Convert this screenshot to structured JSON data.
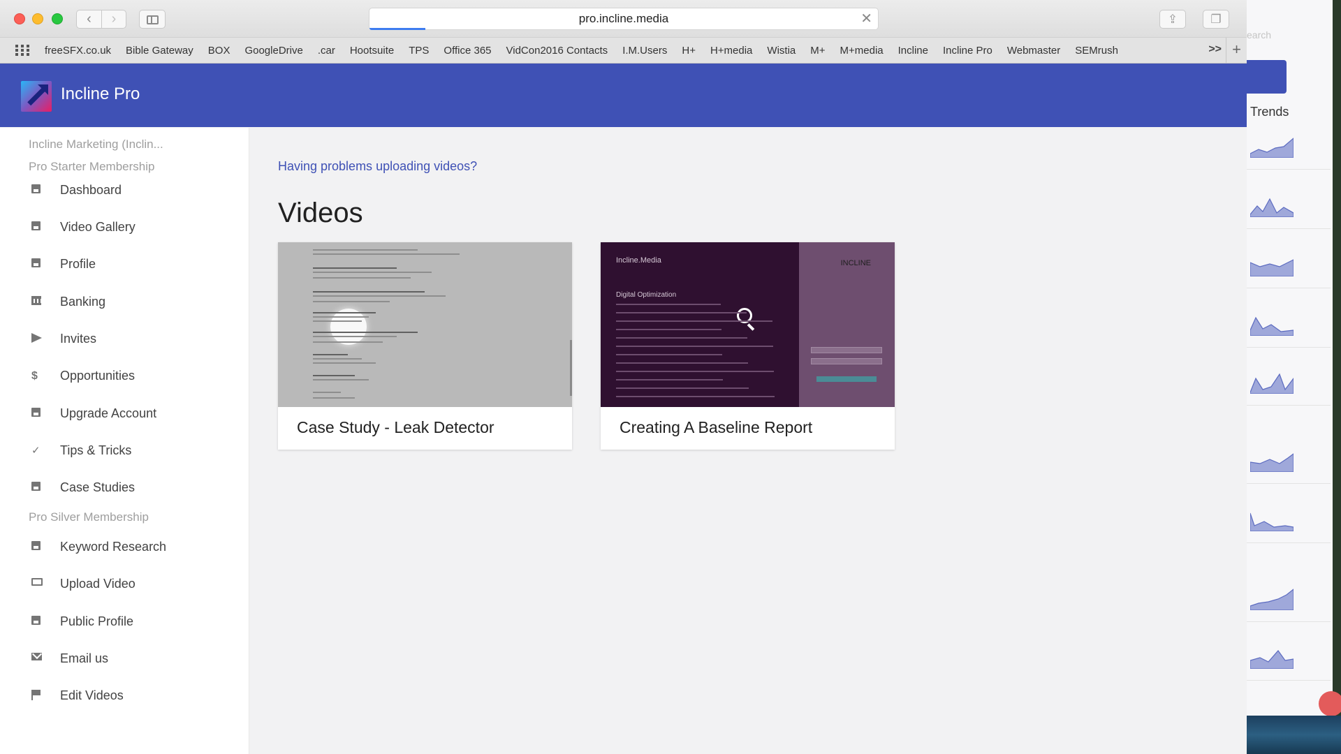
{
  "browser": {
    "url": "pro.incline.media",
    "bookmarks": [
      "freeSFX.co.uk",
      "Bible Gateway",
      "BOX",
      "GoogleDrive",
      ".car",
      "Hootsuite",
      "TPS",
      "Office 365",
      "VidCon2016 Contacts",
      "I.M.Users",
      "H+",
      "H+media",
      "Wistia",
      "M+",
      "M+media",
      "Incline",
      "Incline Pro",
      "Webmaster",
      "SEMrush"
    ],
    "bookmarks_more": ">>",
    "load_progress": 0.11
  },
  "header": {
    "title": "Incline Pro"
  },
  "sidebar": {
    "account": "Incline Marketing (Inclin...",
    "starter_label": "Pro Starter Membership",
    "starter_items": [
      {
        "label": "Dashboard",
        "icon": "dashboard-icon"
      },
      {
        "label": "Video Gallery",
        "icon": "video-gallery-icon"
      },
      {
        "label": "Profile",
        "icon": "profile-icon"
      },
      {
        "label": "Banking",
        "icon": "bank-icon"
      },
      {
        "label": "Invites",
        "icon": "send-icon"
      },
      {
        "label": "Opportunities",
        "icon": "dollar-icon"
      },
      {
        "label": "Upgrade Account",
        "icon": "upgrade-icon"
      },
      {
        "label": "Tips & Tricks",
        "icon": "check-icon"
      },
      {
        "label": "Case Studies",
        "icon": "briefcase-icon"
      }
    ],
    "silver_label": "Pro Silver Membership",
    "silver_items": [
      {
        "label": "Keyword Research",
        "icon": "keyword-icon"
      },
      {
        "label": "Upload Video",
        "icon": "monitor-icon"
      },
      {
        "label": "Public Profile",
        "icon": "contact-icon"
      },
      {
        "label": "Email us",
        "icon": "mail-icon"
      },
      {
        "label": "Edit Videos",
        "icon": "flag-icon"
      }
    ]
  },
  "main": {
    "help_link": "Having problems uploading videos?",
    "title": "Videos",
    "videos": [
      {
        "title": "Case Study - Leak Detector"
      },
      {
        "title": "Creating A Baseline Report",
        "thumb_brand": "Incline.Media",
        "thumb_heading": "Digital Optimization",
        "thumb_logo": "INCLINE"
      }
    ]
  },
  "background_app": {
    "search_placeholder": "earch",
    "trends_label": "Trends"
  },
  "colors": {
    "primary": "#3f51b5",
    "link": "#3f51b5",
    "card_dark": "#2f1030"
  }
}
